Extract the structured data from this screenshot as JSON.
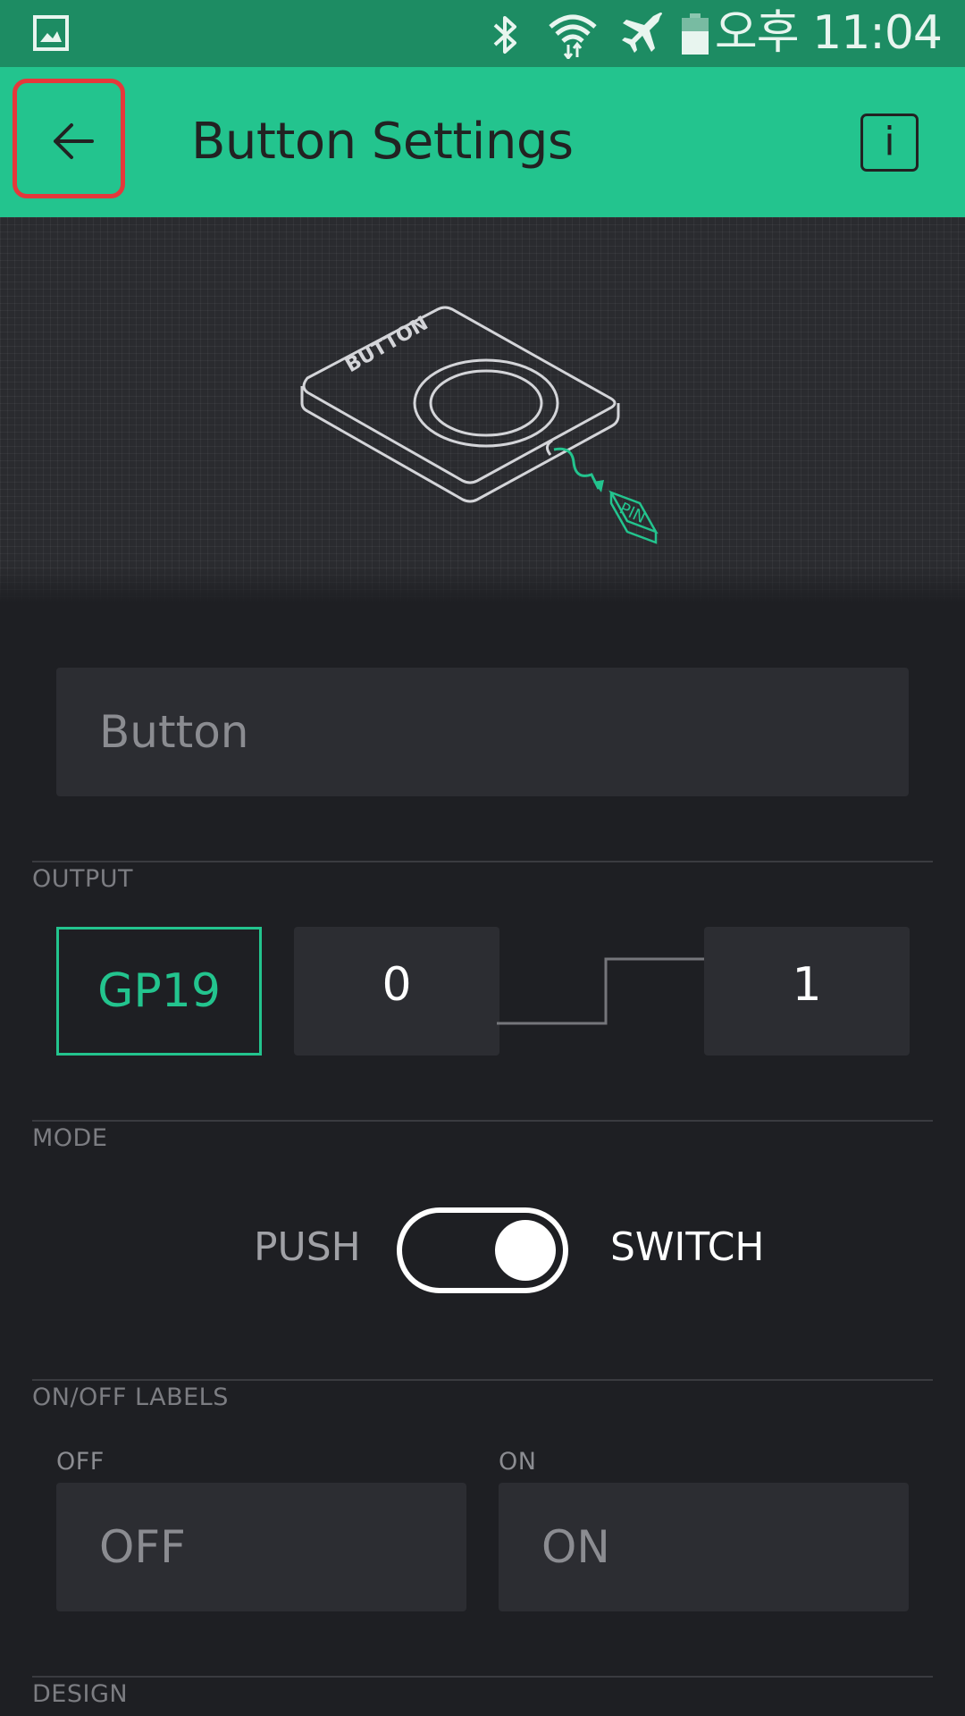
{
  "status_bar": {
    "time": "오후 11:04",
    "icons": [
      "gallery-icon",
      "bluetooth-icon",
      "wifi-icon",
      "airplane-icon",
      "battery-icon"
    ]
  },
  "app_bar": {
    "title": "Button Settings",
    "info_label": "i",
    "background": "#23c48e"
  },
  "illustration": {
    "device_label": "BUTTON",
    "pin_label": "PIN"
  },
  "name_field": {
    "value": "Button"
  },
  "output": {
    "section_label": "OUTPUT",
    "pin": "GP19",
    "low_value": "0",
    "high_value": "1"
  },
  "mode": {
    "section_label": "MODE",
    "push_label": "PUSH",
    "switch_label": "SWITCH",
    "selected": "SWITCH"
  },
  "labels": {
    "section_label": "ON/OFF LABELS",
    "off_caption": "OFF",
    "off_value": "OFF",
    "on_caption": "ON",
    "on_value": "ON"
  },
  "design": {
    "section_label": "DESIGN"
  },
  "colors": {
    "accent": "#23c48e",
    "status_bar": "#1d8c63",
    "background": "#1e1f23",
    "field": "#2c2d32",
    "highlight": "#e5383b"
  }
}
